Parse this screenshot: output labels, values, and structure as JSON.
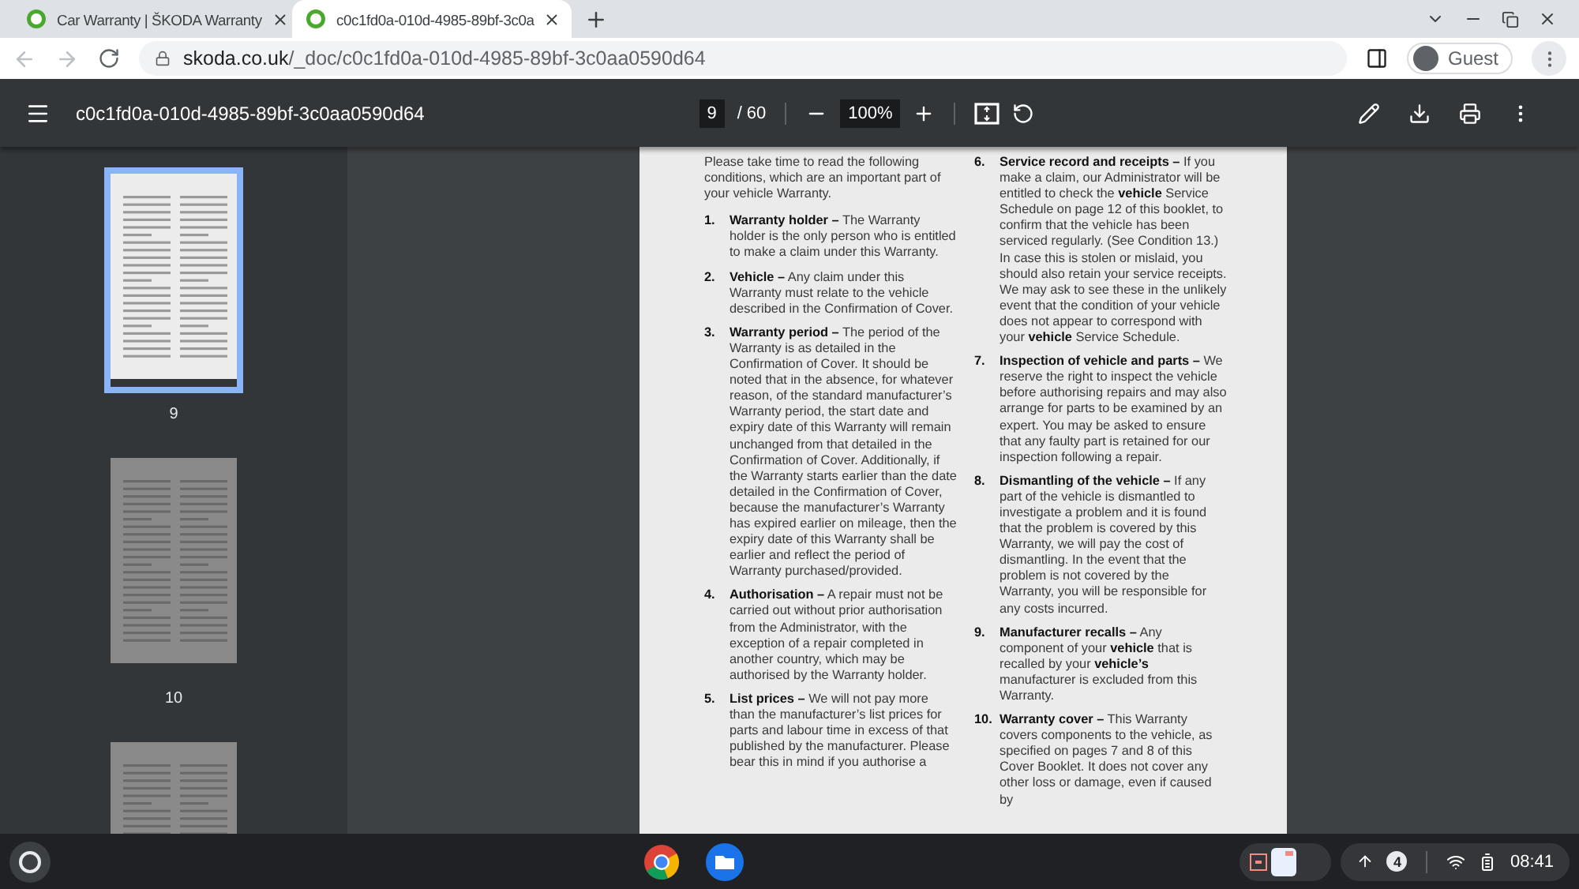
{
  "tabs": [
    {
      "title": "Car Warranty | ŠKODA Warranty",
      "selected": false
    },
    {
      "title": "c0c1fd0a-010d-4985-89bf-3c0a",
      "selected": true
    }
  ],
  "address_bar": {
    "domain": "skoda.co.uk",
    "path": "/_doc/c0c1fd0a-010d-4985-89bf-3c0aa0590d64"
  },
  "profile": {
    "label": "Guest"
  },
  "pdf_toolbar": {
    "title": "c0c1fd0a-010d-4985-89bf-3c0aa0590d64",
    "page": "9",
    "page_total": "/ 60",
    "zoom": "100%"
  },
  "thumbnails": [
    {
      "label": "9",
      "selected": true
    },
    {
      "label": "10",
      "selected": false
    },
    {
      "selected": false
    }
  ],
  "document": {
    "intro": "Please take time to read the following conditions, which are an important part of your vehicle Warranty.",
    "columns": [
      [
        {
          "number": "1.",
          "text": "**Warranty holder –** The Warranty holder is the only person who is entitled to make a claim under this Warranty."
        },
        {
          "number": "2.",
          "text": "**Vehicle –** Any claim under this Warranty must relate to the vehicle described in the Confirmation of Cover."
        },
        {
          "number": "3.",
          "text": "**Warranty period –** The period of the Warranty is as detailed in the Confirmation of Cover. It should be noted that in the absence, for whatever reason, of the standard manufacturer’s Warranty period, the start date and expiry date of this Warranty will remain unchanged from that detailed in the Confirmation of Cover. Additionally, if the Warranty starts earlier than the date detailed in the Confirmation of Cover, because the manufacturer’s Warranty has expired earlier on mileage, then the expiry date of this Warranty shall be earlier and reflect the period of Warranty purchased/provided."
        },
        {
          "number": "4.",
          "text": "**Authorisation –** A repair must not be carried out without prior authorisation from the Administrator, with the exception of a repair completed in another country, which may be authorised by the Warranty holder."
        },
        {
          "number": "5.",
          "text": "**List prices –** We will not pay more than the manufacturer’s list prices for parts and labour time in excess of that published by the manufacturer. Please bear this in mind if you authorise a"
        }
      ],
      [
        {
          "number": "6.",
          "text": "**Service record and receipts –** If you make a claim, our Administrator will be entitled to check the **vehicle** Service Schedule on page 12 of this booklet, to confirm that the vehicle has been serviced regularly. (See Condition 13.) In case this is stolen or mislaid, you should also retain your service receipts. We may ask to see these in the unlikely event that the condition of your vehicle does not appear to correspond with your **vehicle** Service Schedule."
        },
        {
          "number": "7.",
          "text": "**Inspection of vehicle and parts –** We reserve the right to inspect the vehicle before authorising repairs and may also arrange for parts to be examined by an expert. You may be asked to ensure that any faulty part is retained for our inspection following a repair."
        },
        {
          "number": "8.",
          "text": "**Dismantling of the vehicle –** If any part of the vehicle is dismantled to investigate a problem and it is found that the problem is covered by this Warranty, we will pay the cost of dismantling. In the event that the problem is not covered by the Warranty, you will be responsible for any costs incurred."
        },
        {
          "number": "9.",
          "text": "**Manufacturer recalls –** Any component of your **vehicle** that is recalled by your **vehicle’s** manufacturer is excluded from this Warranty."
        },
        {
          "number": "10.",
          "text": "**Warranty cover –** This Warranty covers components to the vehicle, as specified on pages 7 and 8 of this Cover Booklet. It does not cover any other loss or damage, even if caused by"
        }
      ]
    ]
  },
  "shelf": {
    "notification_count": "4",
    "time": "08:41"
  }
}
